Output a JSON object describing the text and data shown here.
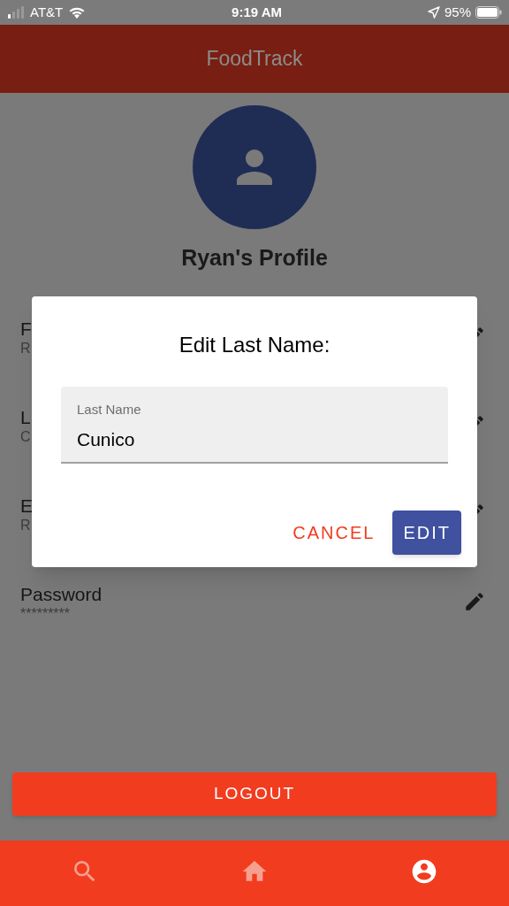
{
  "status_bar": {
    "carrier": "AT&T",
    "time": "9:19 AM",
    "battery": "95%"
  },
  "app_bar": {
    "title": "FoodTrack"
  },
  "profile": {
    "title": "Ryan's Profile"
  },
  "fields": [
    {
      "label": "F",
      "value": "R"
    },
    {
      "label": "L",
      "value": "C"
    },
    {
      "label": "E",
      "value": "R"
    },
    {
      "label": "Password",
      "value": "*********"
    }
  ],
  "dialog": {
    "title": "Edit Last Name:",
    "field": {
      "label": "Last Name",
      "value": "Cunico"
    },
    "buttons": [
      {
        "label": "CANCEL",
        "kind": "text"
      },
      {
        "label": "EDIT",
        "kind": "filled"
      }
    ]
  },
  "logout": {
    "label": "LOGOUT"
  },
  "nav": [
    {
      "kind": "search",
      "selected": false
    },
    {
      "kind": "home",
      "selected": false
    },
    {
      "kind": "account",
      "selected": true
    }
  ]
}
